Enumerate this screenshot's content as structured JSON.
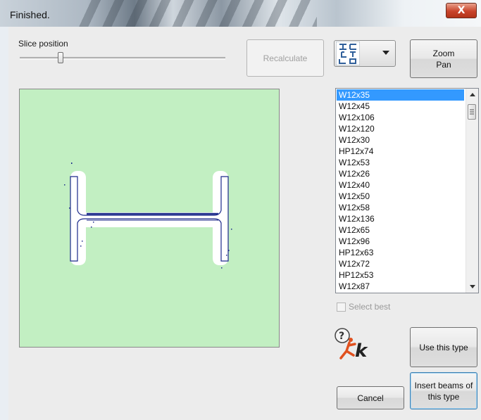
{
  "window": {
    "title": "Finished.",
    "close_glyph": "X"
  },
  "slice": {
    "label": "Slice position",
    "value_fraction": 0.2
  },
  "buttons": {
    "recalculate": "Recalculate",
    "zoom_line1": "Zoom",
    "zoom_line2": "Pan",
    "use_this_type": "Use this type",
    "insert_line1": "Insert beams of",
    "insert_line2": "this type",
    "cancel": "Cancel"
  },
  "shape_combo": {
    "selected_icon": "section-shapes-icon"
  },
  "beam_list": {
    "selected": "W12x35",
    "items": [
      "W12x35",
      "W12x45",
      "W12x106",
      "W12x120",
      "W12x30",
      "HP12x74",
      "W12x53",
      "W12x26",
      "W12x40",
      "W12x50",
      "W12x58",
      "W12x136",
      "W12x65",
      "W12x96",
      "HP12x63",
      "W12x72",
      "HP12x53",
      "W12x87"
    ]
  },
  "select_best": {
    "label": "Select best",
    "checked": false
  },
  "help": {
    "logo_letter": "k",
    "logo_symbol": "?"
  },
  "colors": {
    "preview_bg": "#c2efc2",
    "selection": "#3399ff",
    "section_outline": "#1c2a8a",
    "logo_orange": "#e0501e"
  }
}
